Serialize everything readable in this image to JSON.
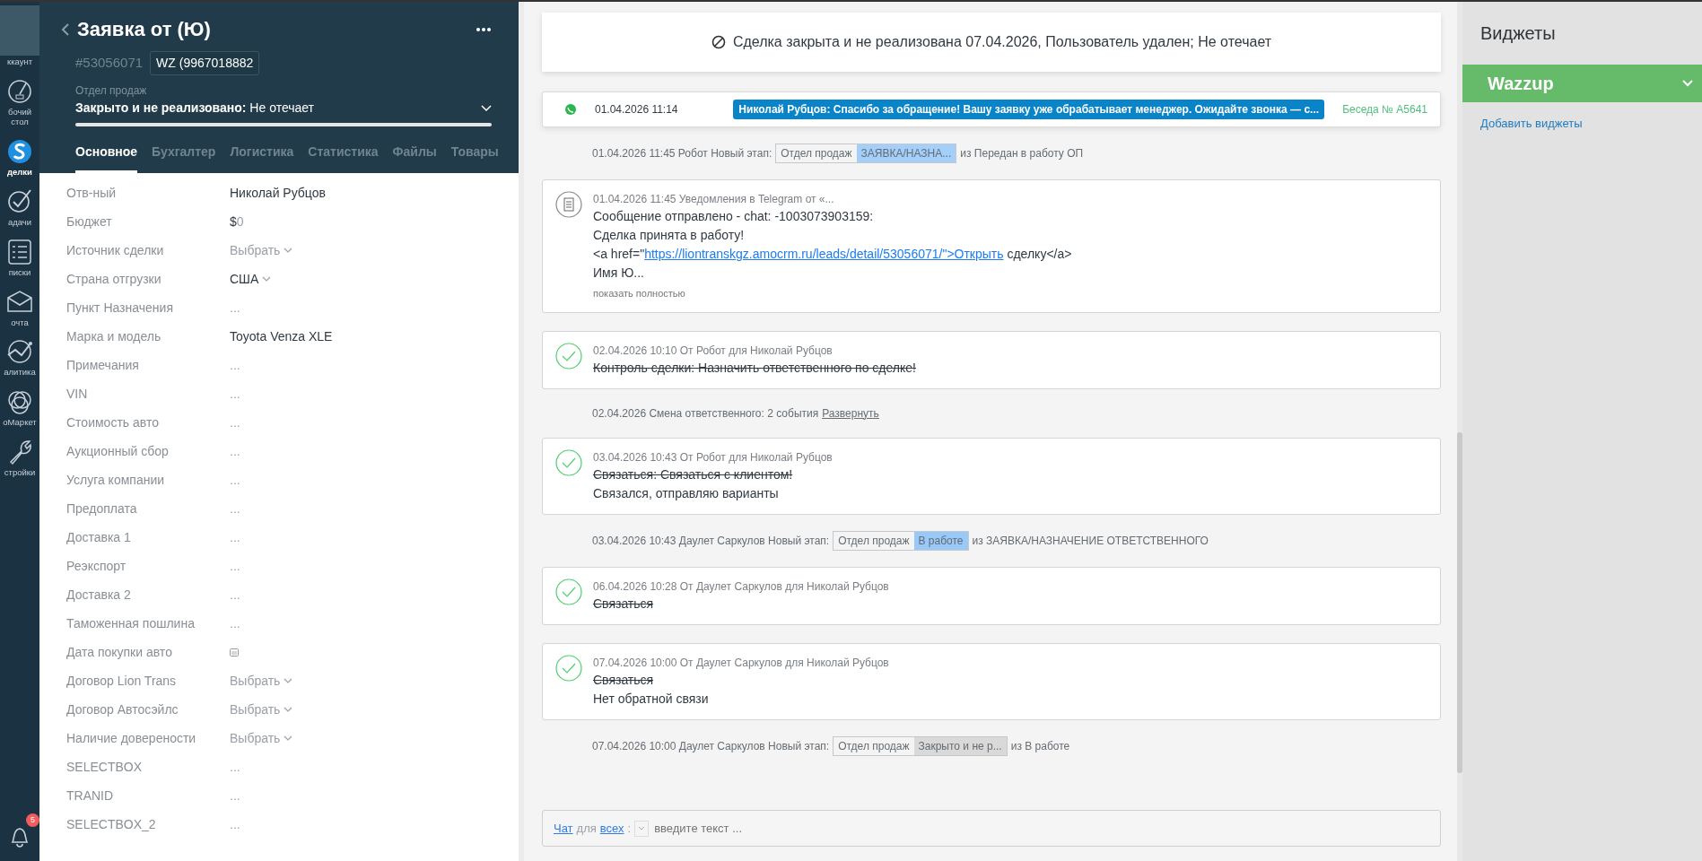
{
  "nav": [
    {
      "label": "ккаунт",
      "kind": "account",
      "selected": false
    },
    {
      "label": "бочий стол",
      "kind": "dashboard",
      "selected": false
    },
    {
      "label": "делки",
      "kind": "deals",
      "selected": true
    },
    {
      "label": "адачи",
      "kind": "tasks",
      "selected": false
    },
    {
      "label": "писки",
      "kind": "lists",
      "selected": false
    },
    {
      "label": "очта",
      "kind": "mail",
      "selected": false
    },
    {
      "label": "алитика",
      "kind": "analytics",
      "selected": false
    },
    {
      "label": "оМаркет",
      "kind": "market",
      "selected": false
    },
    {
      "label": "стройки",
      "kind": "settings",
      "selected": false
    }
  ],
  "notifications": {
    "badge": "5"
  },
  "lead": {
    "title": "Заявка от (Ю)",
    "id": "#53056071",
    "tag": "WZ (9967018882",
    "pipeline": "Отдел продаж",
    "status": "**Закрыто и не реализовано:** Не отечает",
    "level": 1,
    "tabs": [
      {
        "label": "Основное",
        "selected": true
      },
      {
        "label": "Бухгалтер",
        "selected": false
      },
      {
        "label": "Логистика",
        "selected": false
      },
      {
        "label": "Статистика",
        "selected": false
      },
      {
        "label": "Файлы",
        "selected": false
      },
      {
        "label": "Товары",
        "selected": false
      }
    ],
    "fields": [
      {
        "label": "Отв-ный",
        "kind": "text",
        "value": "Николай Рубцов"
      },
      {
        "label": "Бюджет",
        "kind": "money",
        "currency": "$",
        "value": "0"
      },
      {
        "label": "Источник сделки",
        "kind": "select",
        "placeholder": "Выбрать"
      },
      {
        "label": "Страна отгрузки",
        "kind": "select",
        "value": "США"
      },
      {
        "label": "Пункт Назначения",
        "kind": "empty",
        "value": "..."
      },
      {
        "label": "Марка и модель",
        "kind": "text",
        "value": "Toyota Venza XLE"
      },
      {
        "label": "Примечания",
        "kind": "empty",
        "value": "..."
      },
      {
        "label": "VIN",
        "kind": "empty",
        "value": "..."
      },
      {
        "label": "Стоимость авто",
        "kind": "empty",
        "value": "..."
      },
      {
        "label": "Аукционный сбор",
        "kind": "empty",
        "value": "..."
      },
      {
        "label": "Услуга компании",
        "kind": "empty",
        "value": "..."
      },
      {
        "label": "Предоплата",
        "kind": "empty",
        "value": "..."
      },
      {
        "label": "Доставка 1",
        "kind": "empty",
        "value": "..."
      },
      {
        "label": "Реэкспорт",
        "kind": "empty",
        "value": "..."
      },
      {
        "label": "Доставка 2",
        "kind": "empty",
        "value": "..."
      },
      {
        "label": "Таможенная пошлина",
        "kind": "empty",
        "value": "..."
      },
      {
        "label": "Дата покупки авто",
        "kind": "date"
      },
      {
        "label": "Договор Lion Trans",
        "kind": "select",
        "placeholder": "Выбрать"
      },
      {
        "label": "Договор Автосэйлс",
        "kind": "select",
        "placeholder": "Выбрать"
      },
      {
        "label": "Наличие довeрености",
        "kind": "select",
        "placeholder": "Выбрать"
      },
      {
        "label": "SELECTBOX",
        "kind": "empty",
        "value": "..."
      },
      {
        "label": "TRANID",
        "kind": "empty",
        "value": "..."
      },
      {
        "label": "SELECTBOX_2",
        "kind": "empty",
        "value": "..."
      }
    ]
  },
  "feed": {
    "banner": "Сделка закрыта и не реализована 07.04.2026, Пользователь удален; Не отечает",
    "pinned_chat": {
      "time": "01.04.2026 11:14",
      "message": "Николай Рубцов: Спасибо за обращение! Вашу заявку уже обрабатывает менеджер. Ожидайте звонка — с...",
      "conversation": "Беседа № A5641"
    },
    "events": [
      {
        "kind": "stage",
        "text": "01.04.2026 11:45 Робот Новый этап:",
        "pipeline": "Отдел продаж",
        "stage": "ЗАЯВКА/НАЗНА...",
        "color": "#a3cffa",
        "from": "из Передан в работу ОП"
      },
      {
        "kind": "note",
        "meta": "01.04.2026 11:45 Уведомления в Telegram от «...",
        "lines": [
          "Сообщение отправлено - chat: -1003073903159:",
          "Сделка принята в работу!"
        ],
        "link_before": "<a href=\"",
        "link": "https://liontranskgz.amocrm.ru/leads/detail/53056071/\">Открыть",
        "link_after": " сделку</a>",
        "tail": "Имя Ю...",
        "more": "показать полностью"
      },
      {
        "kind": "task",
        "meta": "02.04.2026 10:10  От Робот для Николай Рубцов",
        "title": "Контроль сделки: Назначить ответственного по сделке!",
        "done": true
      },
      {
        "kind": "collapsed",
        "text": "02.04.2026 Смена ответственного: 2 события",
        "link": "Развернуть"
      },
      {
        "kind": "task",
        "meta": "03.04.2026 10:43  От Робот для Николай Рубцов",
        "title": "Связаться: Связаться с клиентом!",
        "done": true,
        "result": "Связался, отправляю варианты"
      },
      {
        "kind": "stage",
        "text": "03.04.2026 10:43 Даулет Саркулов Новый этап:",
        "pipeline": "Отдел продаж",
        "stage": "В работе",
        "color": "#99c9f8",
        "from": "из ЗАЯВКА/НАЗНАЧЕНИЕ ОТВЕТСТВЕННОГО"
      },
      {
        "kind": "task",
        "meta": "06.04.2026 10:28  От Даулет Саркулов для Николай Рубцов",
        "title": "Связаться",
        "done": true
      },
      {
        "kind": "task",
        "meta": "07.04.2026 10:00  От Даулет Саркулов для Николай Рубцов",
        "title": "Связаться",
        "done": true,
        "result": "Нет обратной связи"
      },
      {
        "kind": "stage",
        "text": "07.04.2026 10:00 Даулет Саркулов Новый этап:",
        "pipeline": "Отдел продаж",
        "stage": "Закрыто и не р...",
        "color": "#d9d9d9",
        "from": "из В работе"
      }
    ],
    "chat": {
      "channel": "Чат",
      "middle": "для",
      "target": "всех",
      "separator": ":",
      "placeholder": "введите текст ..."
    }
  },
  "widgets": {
    "title": "Виджеты",
    "items": [
      {
        "label": "Wazzup"
      }
    ],
    "add_link": "Добавить виджеты"
  }
}
